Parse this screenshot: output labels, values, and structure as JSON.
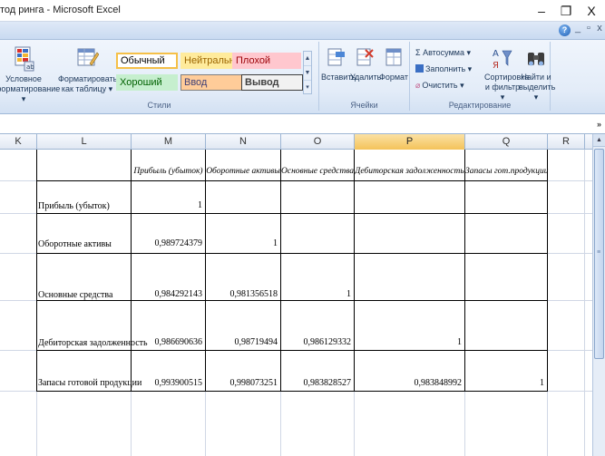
{
  "window": {
    "title": "тод ринга - Microsoft Excel",
    "minimize": "–",
    "restore": "❐",
    "close": "X",
    "mdi_minimize": "_",
    "mdi_restore": "▫",
    "mdi_close": "x",
    "help": "?"
  },
  "ribbon": {
    "styles_group": {
      "label": "Стили",
      "conditional_format": [
        "Условное",
        "форматирование ▾"
      ],
      "format_as_table": [
        "Форматировать",
        "как таблицу ▾"
      ],
      "cell_styles": {
        "normal": "Обычный",
        "neutral": "Нейтральный",
        "bad": "Плохой",
        "good": "Хороший",
        "input": "Ввод",
        "output": "Вывод"
      }
    },
    "cells_group": {
      "label": "Ячейки",
      "insert": "Вставить",
      "delete": "Удалить",
      "format": "Формат"
    },
    "editing_group": {
      "label": "Редактирование",
      "autosum": "Σ Автосумма ▾",
      "fill": "Заполнить ▾",
      "clear": "Очистить ▾",
      "sort_filter": [
        "Сортировка",
        "и фильтр ▾"
      ],
      "find_select": [
        "Найти и",
        "выделить ▾"
      ]
    }
  },
  "grid": {
    "columns": [
      "K",
      "L",
      "M",
      "N",
      "O",
      "P",
      "Q",
      "R"
    ],
    "selected_column": "P",
    "headers": [
      "Прибыль (убыток)",
      "Оборотные активы",
      "Основные средства",
      "Дебиторская задолженность",
      "Запасы гот.продукции"
    ],
    "rows": [
      {
        "label": "Прибыль (убыток)",
        "values": [
          "1",
          "",
          "",
          "",
          ""
        ]
      },
      {
        "label": "Оборотные активы",
        "values": [
          "0,989724379",
          "1",
          "",
          "",
          ""
        ]
      },
      {
        "label": "Основные средства",
        "values": [
          "0,984292143",
          "0,981356518",
          "1",
          "",
          ""
        ]
      },
      {
        "label": "Дебиторская задолженность",
        "values": [
          "0,986690636",
          "0,98719494",
          "0,986129332",
          "1",
          ""
        ]
      },
      {
        "label": "Запасы готовой продукции",
        "values": [
          "0,993900515",
          "0,998073251",
          "0,983828527",
          "0,983848992",
          "1"
        ]
      }
    ]
  }
}
